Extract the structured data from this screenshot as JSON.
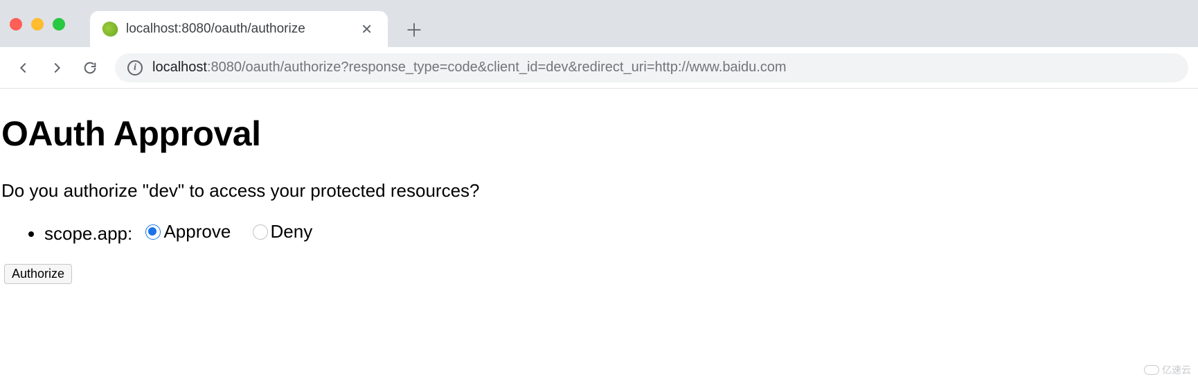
{
  "browser": {
    "tab": {
      "title": "localhost:8080/oauth/authorize"
    },
    "url": {
      "host": "localhost",
      "rest": ":8080/oauth/authorize?response_type=code&client_id=dev&redirect_uri=http://www.baidu.com"
    }
  },
  "page": {
    "heading": "OAuth Approval",
    "prompt": "Do you authorize \"dev\" to access your protected resources?",
    "scope": {
      "label": "scope.app:",
      "approve_label": "Approve",
      "deny_label": "Deny",
      "selected": "approve"
    },
    "submit_label": "Authorize"
  },
  "watermark": "亿速云"
}
